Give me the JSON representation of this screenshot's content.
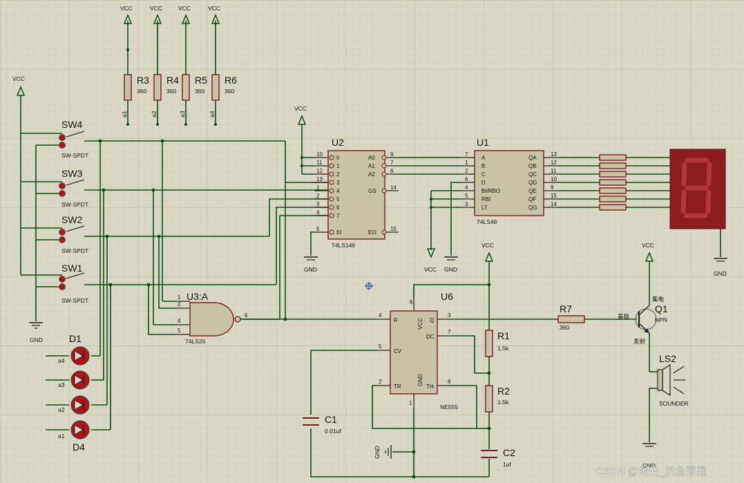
{
  "diagram": {
    "colors": {
      "background": "#d9d7c5",
      "wire": "#0b4f0b",
      "body": "#c8c3a2",
      "outline": "#7a1a1a",
      "display": "#8b1d1d",
      "led": "#b01515"
    },
    "power": {
      "vcc": "VCC",
      "gnd": "GND"
    },
    "resistors_top": [
      {
        "ref": "R3",
        "value": "360",
        "net": "a1"
      },
      {
        "ref": "R4",
        "value": "360",
        "net": "a2"
      },
      {
        "ref": "R5",
        "value": "360",
        "net": "a3"
      },
      {
        "ref": "R6",
        "value": "360",
        "net": "a4"
      }
    ],
    "switches": [
      {
        "ref": "SW4",
        "type": "SW-SPDT"
      },
      {
        "ref": "SW3",
        "type": "SW-SPDT"
      },
      {
        "ref": "SW2",
        "type": "SW-SPDT"
      },
      {
        "ref": "SW1",
        "type": "SW-SPDT"
      }
    ],
    "leds": [
      {
        "ref": "D1",
        "net": "a4"
      },
      {
        "net": "a3"
      },
      {
        "net": "a2"
      },
      {
        "ref": "D4",
        "net": "a1"
      }
    ],
    "u2": {
      "ref": "U2",
      "part": "74LS148",
      "left_pins": [
        {
          "num": "10",
          "name": "0"
        },
        {
          "num": "11",
          "name": "1"
        },
        {
          "num": "12",
          "name": "2"
        },
        {
          "num": "13",
          "name": "3"
        },
        {
          "num": "1",
          "name": "4"
        },
        {
          "num": "2",
          "name": "5"
        },
        {
          "num": "3",
          "name": "6"
        },
        {
          "num": "4",
          "name": "7"
        },
        {
          "num": "5",
          "name": "EI"
        }
      ],
      "right_pins": [
        {
          "num": "9",
          "name": "A0"
        },
        {
          "num": "7",
          "name": "A1"
        },
        {
          "num": "6",
          "name": "A2"
        },
        {
          "num": "14",
          "name": "GS"
        },
        {
          "num": "15",
          "name": "EO"
        }
      ]
    },
    "u1": {
      "ref": "U1",
      "part": "74LS48",
      "left_pins": [
        {
          "num": "7",
          "name": "A"
        },
        {
          "num": "1",
          "name": "B"
        },
        {
          "num": "2",
          "name": "C"
        },
        {
          "num": "6",
          "name": "D"
        },
        {
          "num": "4",
          "name": "BI/RBO"
        },
        {
          "num": "5",
          "name": "RBI"
        },
        {
          "num": "3",
          "name": "LT"
        }
      ],
      "right_pins": [
        {
          "num": "13",
          "name": "QA"
        },
        {
          "num": "12",
          "name": "QB"
        },
        {
          "num": "11",
          "name": "QC"
        },
        {
          "num": "10",
          "name": "QD"
        },
        {
          "num": "9",
          "name": "QE"
        },
        {
          "num": "15",
          "name": "QF"
        },
        {
          "num": "14",
          "name": "QG"
        }
      ]
    },
    "u3": {
      "ref": "U3:A",
      "part": "74LS20",
      "inputs": [
        "1",
        "2",
        "4",
        "5"
      ],
      "output": "6"
    },
    "u6": {
      "ref": "U6",
      "part": "NE555",
      "pins": {
        "r": {
          "num": "4",
          "name": "R"
        },
        "vcc": {
          "num": "8",
          "name": "VCC"
        },
        "q": {
          "num": "3",
          "name": "Q"
        },
        "dc": {
          "num": "7",
          "name": "DC"
        },
        "cv": {
          "num": "5",
          "name": "CV"
        },
        "tr": {
          "num": "2",
          "name": "TR"
        },
        "gnd": {
          "num": "1",
          "name": "GND"
        },
        "th": {
          "num": "6",
          "name": "TH"
        }
      }
    },
    "r7": {
      "ref": "R7",
      "value": "360"
    },
    "r1": {
      "ref": "R1",
      "value": "1.5k"
    },
    "r2": {
      "ref": "R2",
      "value": "1.5k"
    },
    "c1": {
      "ref": "C1",
      "value": "0.01uf"
    },
    "c2": {
      "ref": "C2",
      "value": "1uf"
    },
    "q1": {
      "ref": "Q1",
      "type": "NPN",
      "collector": "集电",
      "base": "基极",
      "emitter": "发射"
    },
    "ls2": {
      "ref": "LS2",
      "type": "SOUNDER"
    },
    "watermark": "CSDN @闲云_沉鱼落雁"
  }
}
